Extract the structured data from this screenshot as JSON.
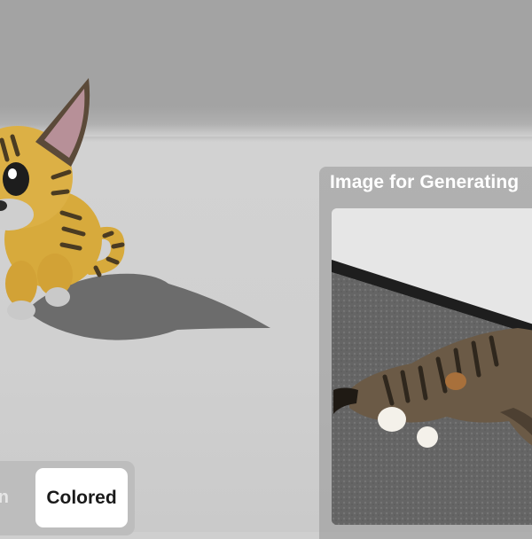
{
  "reference_panel": {
    "title": "Image for Generating"
  },
  "mode_toggle": {
    "active_label": "Colored",
    "previous_label_fragment": "n"
  },
  "model": {
    "subject": "cartoon tabby kitten 3D model",
    "body_color": "#d7aa3c",
    "stripe_color": "#4a3b22",
    "paw_color": "#c9c9c9"
  },
  "photo": {
    "subject": "tabby cat lying on carpet"
  }
}
